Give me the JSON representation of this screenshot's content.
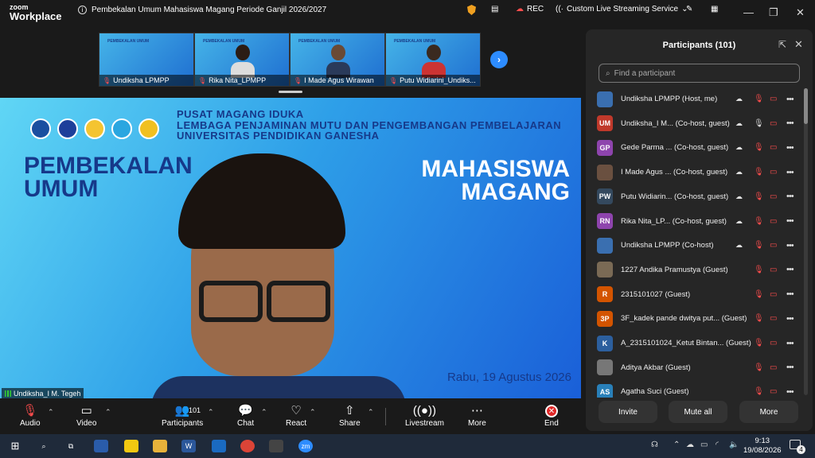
{
  "app": {
    "logo_line1": "zoom",
    "logo_line2": "Workplace",
    "meeting_title": "Pembekalan Umum Mahasiswa Magang Periode Ganjil 2026/2027"
  },
  "titlebar": {
    "rec_label": "REC",
    "streaming_label": "Custom Live Streaming Service"
  },
  "thumbnails": [
    {
      "name": "Undiksha LPMPP"
    },
    {
      "name": "Rika Nita_LPMPP"
    },
    {
      "name": "I Made Agus Wirawan"
    },
    {
      "name": "Putu Widiarini_Undiks..."
    }
  ],
  "slide": {
    "title_line1": "PUSAT MAGANG IDUKA",
    "title_line2": "LEMBAGA PENJAMINAN MUTU DAN PENGEMBANGAN PEMBELAJARAN",
    "title_line3": "UNIVERSITAS PENDIDIKAN GANESHA",
    "left_line1": "PEMBEKALAN",
    "left_line2": "UMUM",
    "right_line1": "MAHASISWA",
    "right_line2": "MAGANG",
    "date": "Rabu, 19 Agustus 2026",
    "thumb_text": "PEMBEKALAN UMUM",
    "thumb_text2": "MAHASISWA MAGANG"
  },
  "active_speaker": "Undiksha_I M. Tegeh",
  "toolbar": {
    "audio": "Audio",
    "video": "Video",
    "participants": "Participants",
    "participants_count": "101",
    "chat": "Chat",
    "react": "React",
    "share": "Share",
    "livestream": "Livestream",
    "more": "More",
    "end": "End"
  },
  "panel": {
    "title": "Participants (101)",
    "search_placeholder": "Find a participant",
    "invite": "Invite",
    "mute_all": "Mute all",
    "more": "More"
  },
  "participants": [
    {
      "initials": "",
      "color": "#3a6fb0",
      "name": "Undiksha LPMPP (Host, me)",
      "cloud": true,
      "mic_on": false
    },
    {
      "initials": "UM",
      "color": "#c0392b",
      "name": "Undiksha_I M... (Co-host, guest)",
      "cloud": true,
      "mic_on": true
    },
    {
      "initials": "GP",
      "color": "#8e44ad",
      "name": "Gede Parma ... (Co-host, guest)",
      "cloud": true,
      "mic_on": false
    },
    {
      "initials": "",
      "color": "#6a5040",
      "name": "I Made Agus ... (Co-host, guest)",
      "cloud": true,
      "mic_on": false
    },
    {
      "initials": "PW",
      "color": "#34495e",
      "name": "Putu Widiarin... (Co-host, guest)",
      "cloud": true,
      "mic_on": false
    },
    {
      "initials": "RN",
      "color": "#8e44ad",
      "name": "Rika Nita_LP... (Co-host, guest)",
      "cloud": true,
      "mic_on": false
    },
    {
      "initials": "",
      "color": "#3a6fb0",
      "name": "Undiksha LPMPP (Co-host)",
      "cloud": true,
      "mic_on": false
    },
    {
      "initials": "",
      "color": "#7a6a55",
      "name": "1227 Andika Pramustya (Guest)",
      "cloud": false,
      "mic_on": false
    },
    {
      "initials": "R",
      "color": "#d35400",
      "name": "2315101027 (Guest)",
      "cloud": false,
      "mic_on": false
    },
    {
      "initials": "3P",
      "color": "#d35400",
      "name": "3F_kadek pande dwitya put... (Guest)",
      "cloud": false,
      "mic_on": false
    },
    {
      "initials": "K",
      "color": "#2c5f9e",
      "name": "A_2315101024_Ketut Bintan... (Guest)",
      "cloud": false,
      "mic_on": false
    },
    {
      "initials": "",
      "color": "#777",
      "name": "Aditya Akbar (Guest)",
      "cloud": false,
      "mic_on": false
    },
    {
      "initials": "AS",
      "color": "#2980b9",
      "name": "Agatha Suci (Guest)",
      "cloud": false,
      "mic_on": false
    }
  ],
  "taskbar": {
    "time": "9:13",
    "date": "19/08/2026",
    "notif_count": "4"
  },
  "colors": {
    "accent": "#2d8cff",
    "end_red": "#e02828",
    "muted_red": "#ff4d4d"
  }
}
